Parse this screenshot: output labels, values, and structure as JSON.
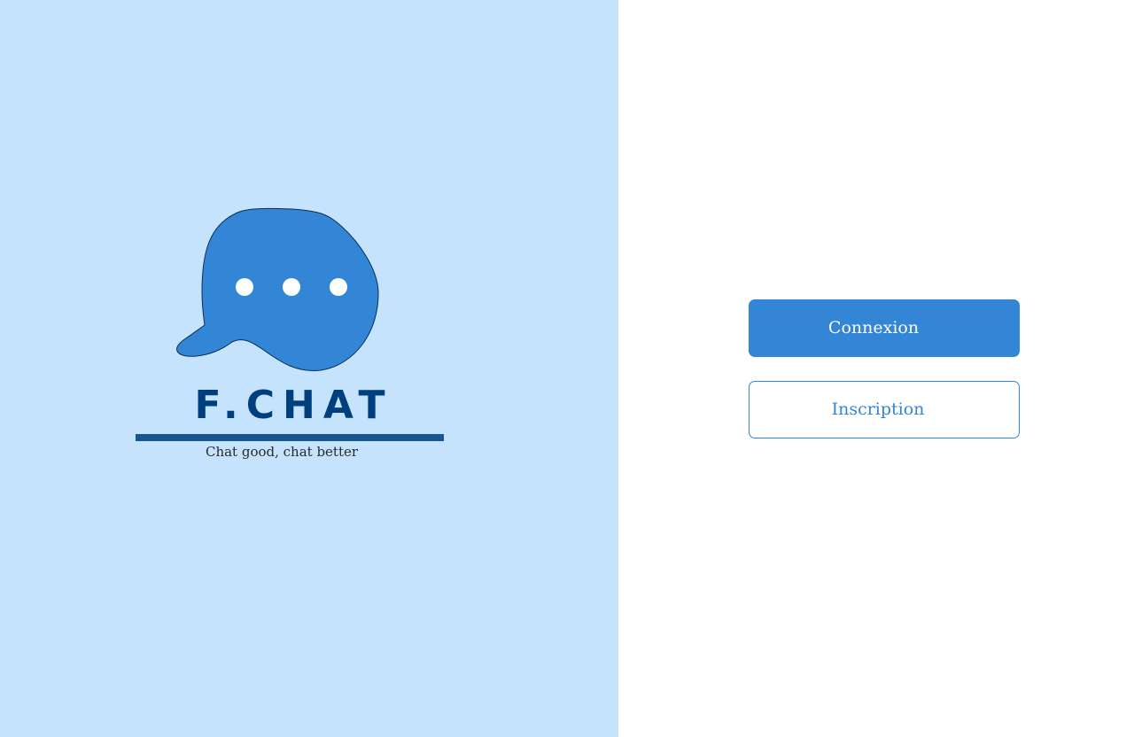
{
  "brand": {
    "name": "F.CHAT",
    "tagline": "Chat good, chat better",
    "logo_icon": "chat-bubble-icon",
    "colors": {
      "left_panel_bg": "#c5e3fd",
      "bubble_fill": "#3385d6",
      "wordmark": "#003f7d",
      "underline": "#19568f"
    }
  },
  "actions": {
    "login_label": "Connexion",
    "signup_label": "Inscription",
    "accent": "#3385d6"
  }
}
